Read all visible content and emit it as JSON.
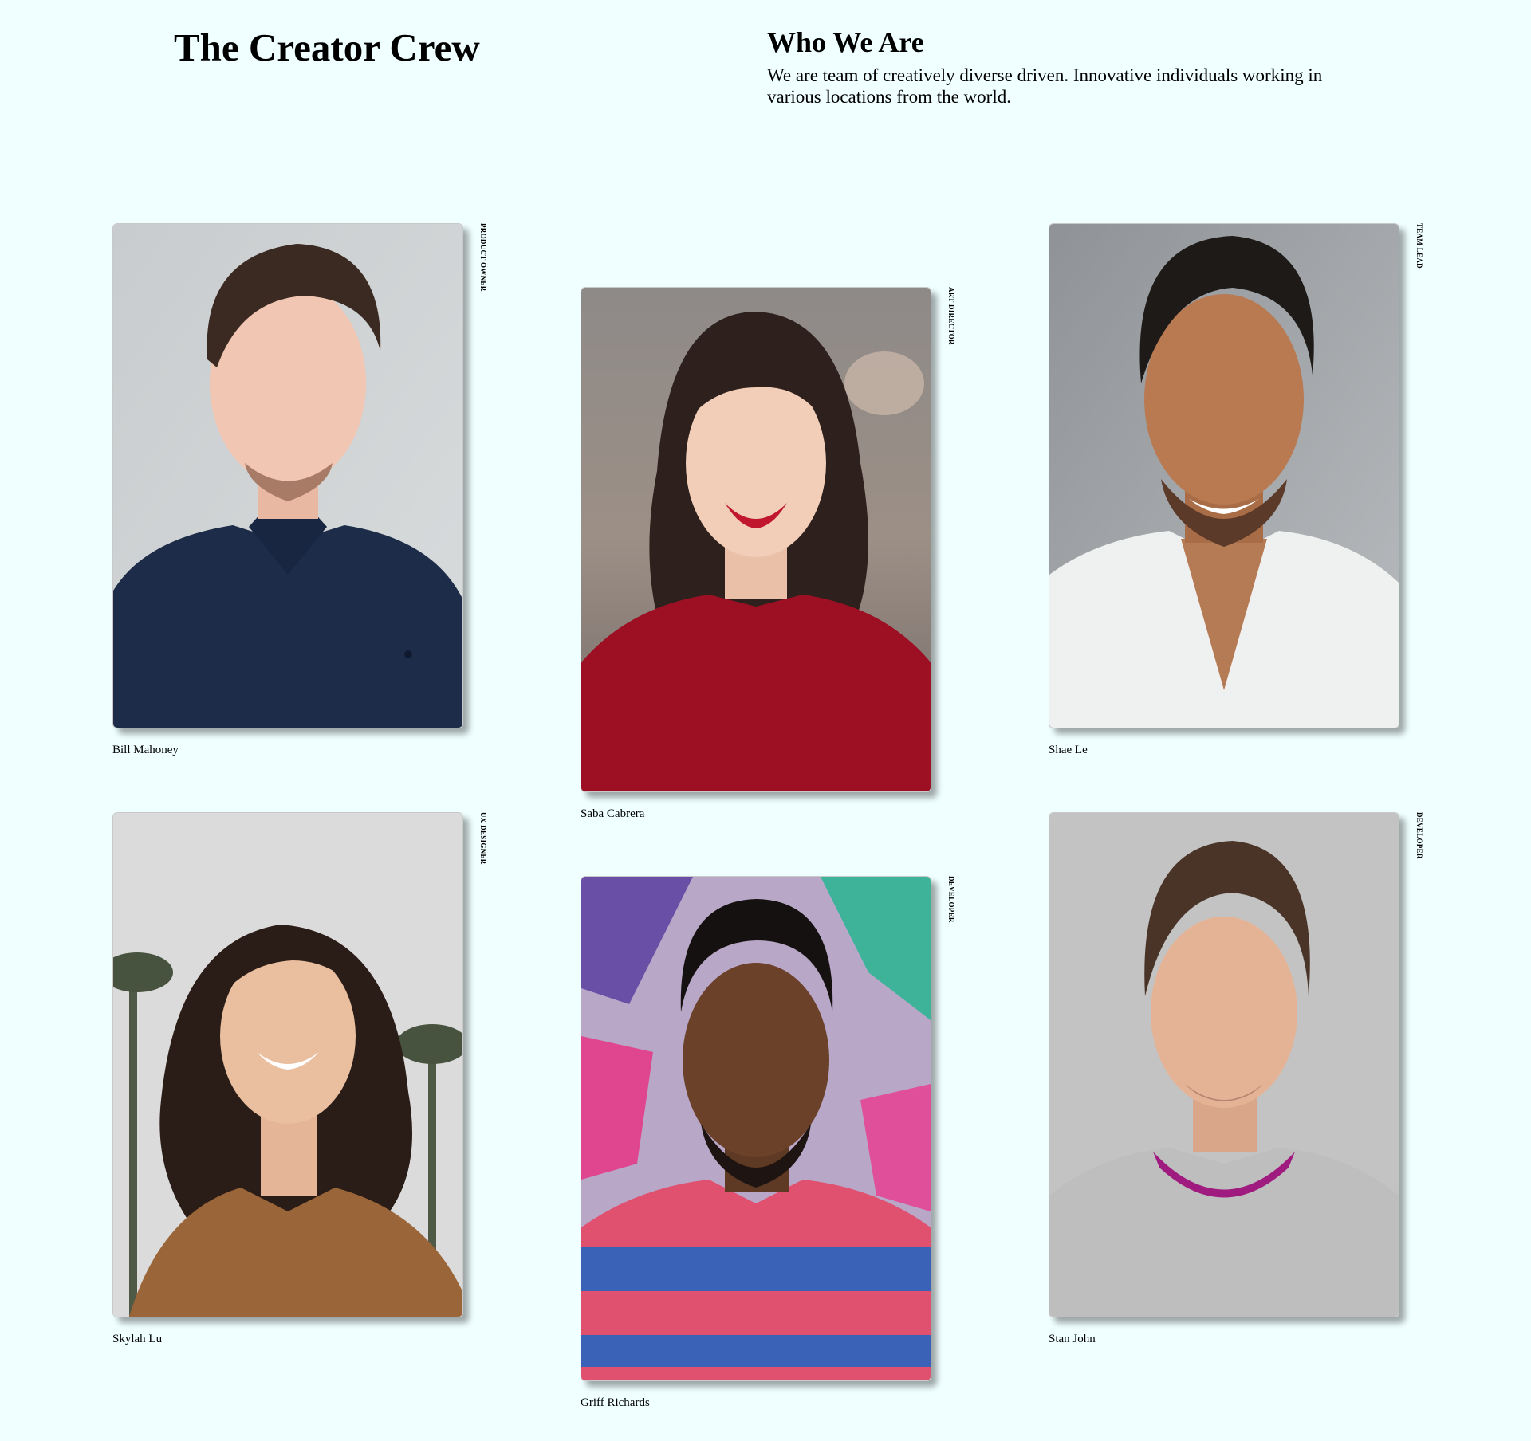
{
  "header": {
    "title": "The Creator Crew"
  },
  "about": {
    "heading": "Who We Are",
    "text": "We are team of creatively diverse driven. Innovative individuals working in various locations from the world."
  },
  "team": [
    {
      "name": "Bill Mahoney",
      "role": "PRODUCT OWNER",
      "photo_icon": "portrait-man-navy-polo"
    },
    {
      "name": "Saba Cabrera",
      "role": "ART DIRECTOR",
      "photo_icon": "portrait-woman-red-sweater"
    },
    {
      "name": "Shae Le",
      "role": "TEAM LEAD",
      "photo_icon": "portrait-man-white-tee"
    },
    {
      "name": "Skylah Lu",
      "role": "UX DESIGNER",
      "photo_icon": "portrait-woman-leopard-blouse"
    },
    {
      "name": "Griff Richards",
      "role": "DEVELOPER",
      "photo_icon": "portrait-man-striped-shirt"
    },
    {
      "name": "Stan John",
      "role": "DEVELOPER",
      "photo_icon": "portrait-man-grey-sweatshirt"
    }
  ],
  "colors": {
    "background": "#f0ffff",
    "text": "#000000"
  }
}
